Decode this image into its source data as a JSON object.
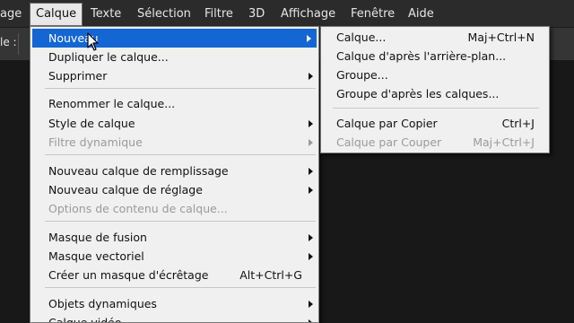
{
  "menubar": {
    "items": [
      "age",
      "Calque",
      "Texte",
      "Sélection",
      "Filtre",
      "3D",
      "Affichage",
      "Fenêtre",
      "Aide"
    ]
  },
  "optbar": {
    "label": "le :"
  },
  "menu": {
    "items": [
      {
        "label": "Nouveau",
        "arrow": true
      },
      {
        "label": "Dupliquer le calque..."
      },
      {
        "label": "Supprimer",
        "arrow": true
      },
      {
        "label": "Renommer le calque..."
      },
      {
        "label": "Style de calque",
        "arrow": true
      },
      {
        "label": "Filtre dynamique",
        "arrow": true,
        "disabled": true
      },
      {
        "label": "Nouveau calque de remplissage",
        "arrow": true
      },
      {
        "label": "Nouveau calque de réglage",
        "arrow": true
      },
      {
        "label": "Options de contenu de calque...",
        "disabled": true
      },
      {
        "label": "Masque de fusion",
        "arrow": true
      },
      {
        "label": "Masque vectoriel",
        "arrow": true
      },
      {
        "label": "Créer un masque d'écrêtage",
        "shortcut": "Alt+Ctrl+G"
      },
      {
        "label": "Objets dynamiques",
        "arrow": true
      },
      {
        "label": "Calque vidéo",
        "arrow": true
      }
    ]
  },
  "submenu": {
    "items": [
      {
        "label": "Calque...",
        "shortcut": "Maj+Ctrl+N"
      },
      {
        "label": "Calque d'après l'arrière-plan..."
      },
      {
        "label": "Groupe..."
      },
      {
        "label": "Groupe d'après les calques..."
      },
      {
        "label": "Calque par Copier",
        "shortcut": "Ctrl+J"
      },
      {
        "label": "Calque par Couper",
        "shortcut": "Maj+Ctrl+J",
        "disabled": true
      }
    ]
  },
  "colors": {
    "highlight": "#1467d3",
    "menu_bg": "#f0f0f0",
    "menubar_bg": "#2b2b2b"
  }
}
